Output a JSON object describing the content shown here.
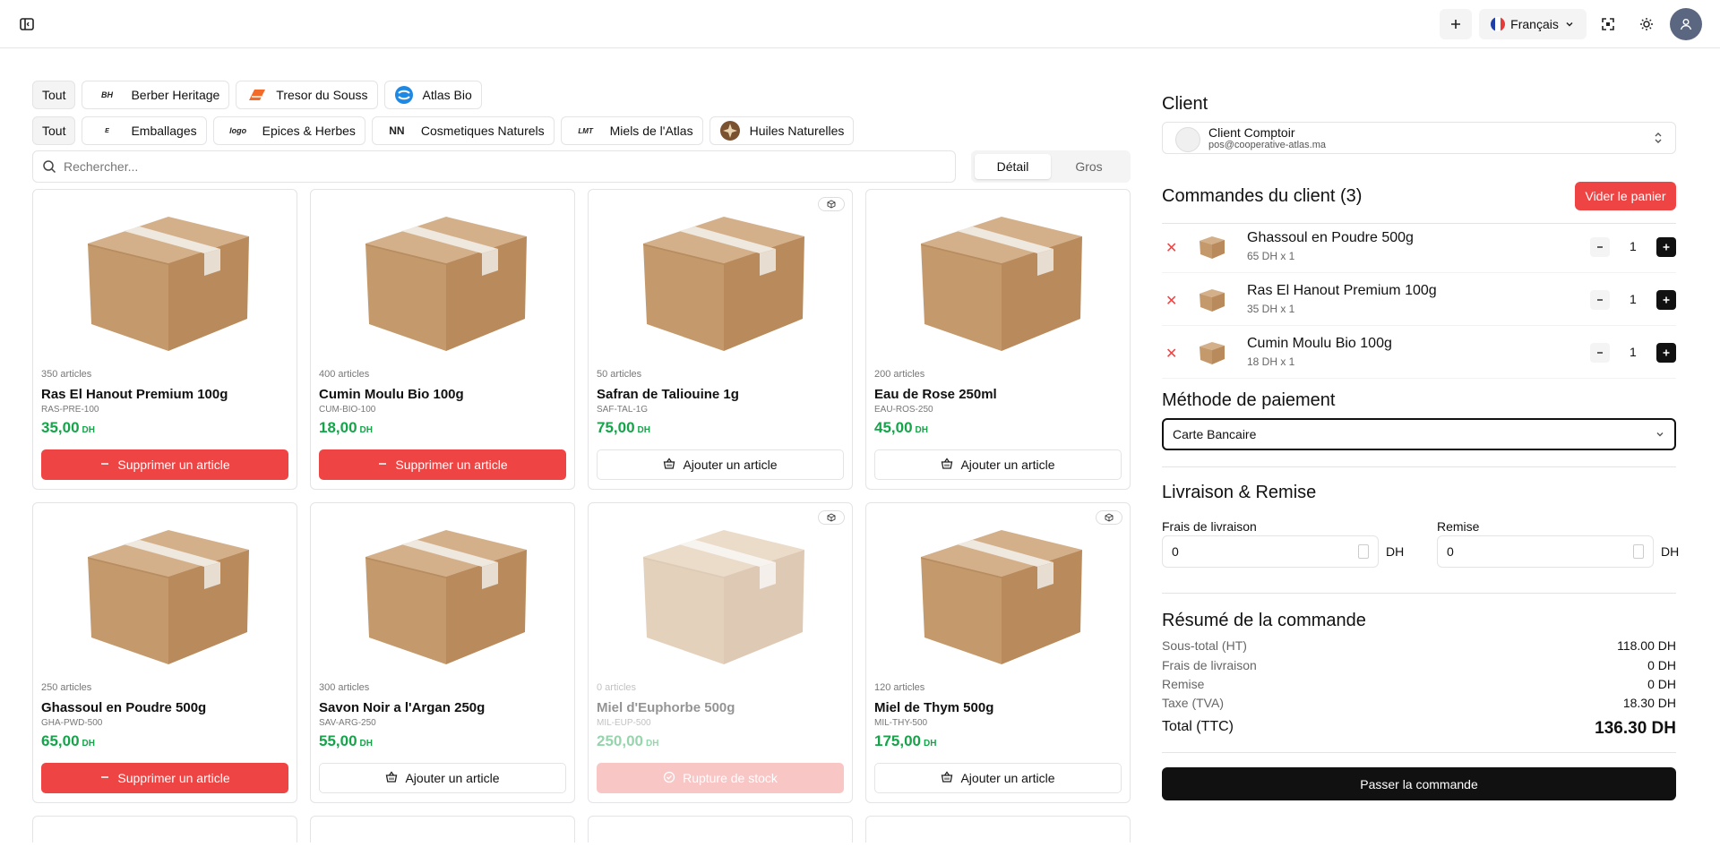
{
  "header": {
    "language": "Français"
  },
  "filters": {
    "brands": [
      {
        "label": "Tout",
        "logo": ""
      },
      {
        "label": "Berber Heritage",
        "logo": "BH"
      },
      {
        "label": "Tresor du Souss",
        "logo": ""
      },
      {
        "label": "Atlas Bio",
        "logo": ""
      }
    ],
    "categories": [
      {
        "label": "Tout",
        "logo": ""
      },
      {
        "label": "Emballages",
        "logo": "E"
      },
      {
        "label": "Epices & Herbes",
        "logo": "logo"
      },
      {
        "label": "Cosmetiques Naturels",
        "logo": "NN"
      },
      {
        "label": "Miels de l'Atlas",
        "logo": "LMT"
      },
      {
        "label": "Huiles Naturelles",
        "logo": ""
      }
    ]
  },
  "search": {
    "placeholder": "Rechercher..."
  },
  "mode": {
    "detail": "Détail",
    "wholesale": "Gros",
    "selected": "Détail"
  },
  "products": [
    {
      "count": "350 articles",
      "name": "Ras El Hanout Premium 100g",
      "sku": "RAS-PRE-100",
      "price": "35,00",
      "currency": "DH",
      "action": "Supprimer un article",
      "state": "remove",
      "badge": false
    },
    {
      "count": "400 articles",
      "name": "Cumin Moulu Bio 100g",
      "sku": "CUM-BIO-100",
      "price": "18,00",
      "currency": "DH",
      "action": "Supprimer un article",
      "state": "remove",
      "badge": false
    },
    {
      "count": "50 articles",
      "name": "Safran de Taliouine 1g",
      "sku": "SAF-TAL-1G",
      "price": "75,00",
      "currency": "DH",
      "action": "Ajouter un article",
      "state": "add",
      "badge": true
    },
    {
      "count": "200 articles",
      "name": "Eau de Rose 250ml",
      "sku": "EAU-ROS-250",
      "price": "45,00",
      "currency": "DH",
      "action": "Ajouter un article",
      "state": "add",
      "badge": false
    },
    {
      "count": "250 articles",
      "name": "Ghassoul en Poudre 500g",
      "sku": "GHA-PWD-500",
      "price": "65,00",
      "currency": "DH",
      "action": "Supprimer un article",
      "state": "remove",
      "badge": false
    },
    {
      "count": "300 articles",
      "name": "Savon Noir a l'Argan 250g",
      "sku": "SAV-ARG-250",
      "price": "55,00",
      "currency": "DH",
      "action": "Ajouter un article",
      "state": "add",
      "badge": false
    },
    {
      "count": "0 articles",
      "name": "Miel d'Euphorbe 500g",
      "sku": "MIL-EUP-500",
      "price": "250,00",
      "currency": "DH",
      "action": "Rupture de stock",
      "state": "out",
      "badge": true
    },
    {
      "count": "120 articles",
      "name": "Miel de Thym 500g",
      "sku": "MIL-THY-500",
      "price": "175,00",
      "currency": "DH",
      "action": "Ajouter un article",
      "state": "add",
      "badge": true
    }
  ],
  "client": {
    "title": "Client",
    "name": "Client Comptoir",
    "email": "pos@cooperative-atlas.ma"
  },
  "orders": {
    "title": "Commandes du client (3)",
    "clear_label": "Vider le panier",
    "items": [
      {
        "name": "Ghassoul en Poudre 500g",
        "detail": "65 DH x 1",
        "qty": "1"
      },
      {
        "name": "Ras El Hanout Premium 100g",
        "detail": "35 DH x 1",
        "qty": "1"
      },
      {
        "name": "Cumin Moulu Bio 100g",
        "detail": "18 DH x 1",
        "qty": "1"
      }
    ]
  },
  "payment": {
    "title": "Méthode de paiement",
    "selected": "Carte Bancaire"
  },
  "delivery": {
    "title": "Livraison & Remise",
    "fee_label": "Frais de livraison",
    "fee_value": "0",
    "discount_label": "Remise",
    "discount_value": "0",
    "unit": "DH"
  },
  "summary": {
    "title": "Résumé de la commande",
    "rows": [
      {
        "label": "Sous-total (HT)",
        "value": "118.00 DH"
      },
      {
        "label": "Frais de livraison",
        "value": "0 DH"
      },
      {
        "label": "Remise",
        "value": "0 DH"
      },
      {
        "label": "Taxe (TVA)",
        "value": "18.30 DH"
      }
    ],
    "total_label": "Total (TTC)",
    "total_value": "136.30 DH",
    "checkout_label": "Passer la commande"
  },
  "colors": {
    "accent_red": "#ef4444",
    "price_green": "#16a34a",
    "primary_dark": "#111111"
  }
}
